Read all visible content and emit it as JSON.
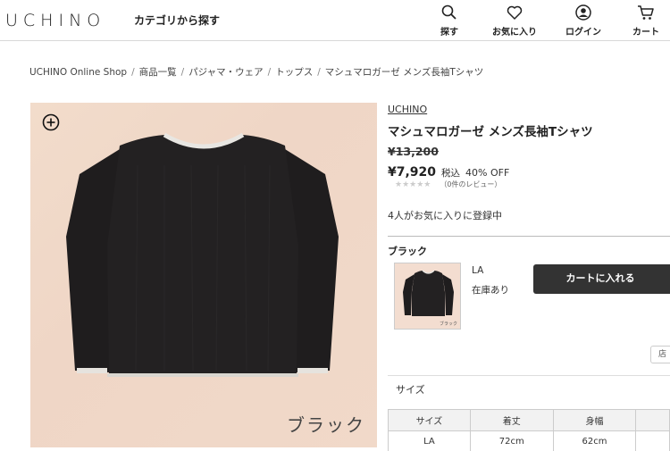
{
  "header": {
    "logo": "UCHINO",
    "category_link": "カテゴリから探す",
    "nav": [
      {
        "label": "探す",
        "icon": "search-icon"
      },
      {
        "label": "お気に入り",
        "icon": "heart-icon"
      },
      {
        "label": "ログイン",
        "icon": "user-icon"
      },
      {
        "label": "カート",
        "icon": "cart-icon"
      }
    ]
  },
  "breadcrumb": [
    "UCHINO Online Shop",
    "商品一覧",
    "パジャマ・ウェア",
    "トップス",
    "マシュマロガーゼ メンズ長袖Tシャツ"
  ],
  "breadcrumb_separator": "/",
  "image": {
    "caption": "ブラック",
    "thumb_caption": "ブラック"
  },
  "product": {
    "brand": "UCHINO",
    "title": "マシュマロガーゼ メンズ長袖Tシャツ",
    "original_price": "¥13,200",
    "price": "¥7,920",
    "tax": "税込",
    "discount": "40% OFF",
    "stars": "★★★★★",
    "reviews": "（0件のレビュー）",
    "favorites": "4人がお気に入りに登録中",
    "color": "ブラック",
    "size": "LA",
    "stock": "在庫あり",
    "cart_button": "カートに入れる",
    "store_button": "店",
    "size_heading": "サイズ"
  },
  "size_table": {
    "headers": [
      "サイズ",
      "着丈",
      "身幅",
      ""
    ],
    "rows": [
      [
        "LA",
        "72cm",
        "62cm",
        ""
      ]
    ]
  },
  "colors": {
    "accent": "#333333",
    "image_bg": "#f1d9c9",
    "garment": "#1f1d1e"
  }
}
